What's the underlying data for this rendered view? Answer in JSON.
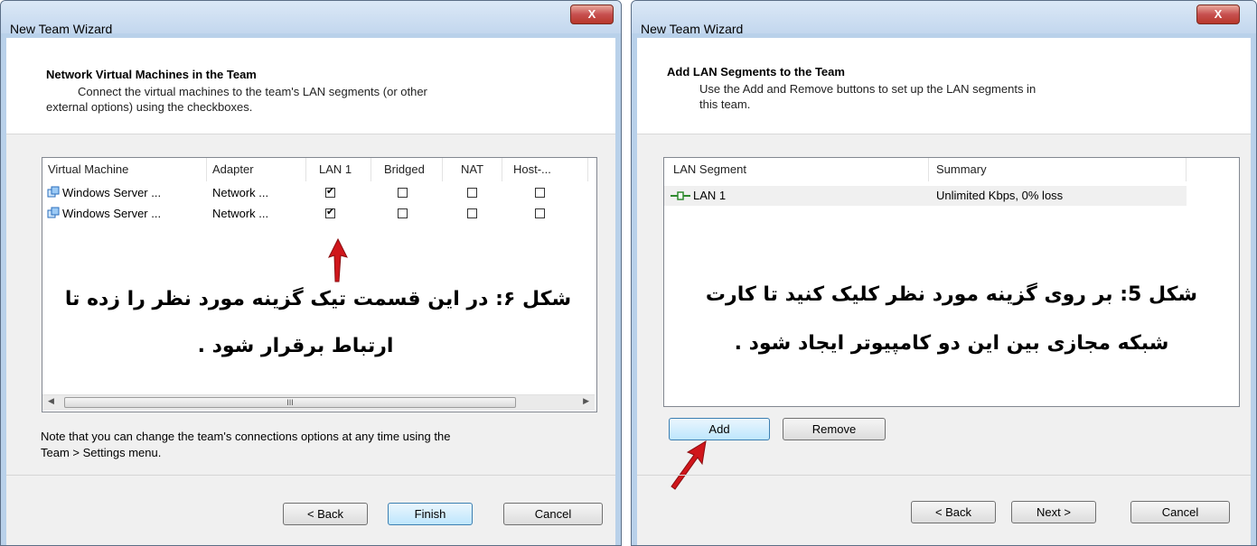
{
  "left_window": {
    "title": "New Team Wizard",
    "close_label": "X",
    "header": {
      "title": "Network Virtual Machines in the Team",
      "description_line1": "Connect the virtual machines to the team's LAN segments (or other",
      "description_line2": "external options) using the checkboxes."
    },
    "table": {
      "columns": [
        "Virtual Machine",
        "Adapter",
        "LAN 1",
        "Bridged",
        "NAT",
        "Host-..."
      ],
      "rows": [
        {
          "vm": "Windows Server ...",
          "adapter": "Network ...",
          "lan1": true,
          "bridged": false,
          "nat": false,
          "host": false
        },
        {
          "vm": "Windows Server ...",
          "adapter": "Network ...",
          "lan1": true,
          "bridged": false,
          "nat": false,
          "host": false
        }
      ],
      "scroll_thumb_grip": "III"
    },
    "annotation_line1": "شکل ۶: در این قسمت تیک گزینه مورد نظر را زده تا",
    "annotation_line2": "ارتباط برقرار شود .",
    "note_line1": "Note that you can change the team's connections options at any time using the",
    "note_line2": "Team > Settings menu.",
    "buttons": {
      "back": "< Back",
      "finish": "Finish",
      "cancel": "Cancel"
    }
  },
  "right_window": {
    "title": "New Team Wizard",
    "close_label": "X",
    "header": {
      "title": "Add LAN Segments to the Team",
      "description_line1": "Use the Add and Remove buttons to set up the LAN segments in",
      "description_line2": "this team."
    },
    "table": {
      "columns": [
        "LAN Segment",
        "Summary"
      ],
      "rows": [
        {
          "segment": "LAN 1",
          "summary": "Unlimited Kbps, 0% loss"
        }
      ]
    },
    "annotation_line1": "شکل 5: بر روی گزینه  مورد نظر کلیک کنید تا کارت",
    "annotation_line2": "شبکه مجازی بین این دو کامپیوتر ایجاد شود .",
    "buttons": {
      "add": "Add",
      "remove": "Remove",
      "back": "< Back",
      "next": "Next >",
      "cancel": "Cancel"
    }
  },
  "colors": {
    "window_frame": "#b9d1ea",
    "close_button": "#c75050",
    "arrow": "#d0161b",
    "default_button": "#bee6fd"
  }
}
